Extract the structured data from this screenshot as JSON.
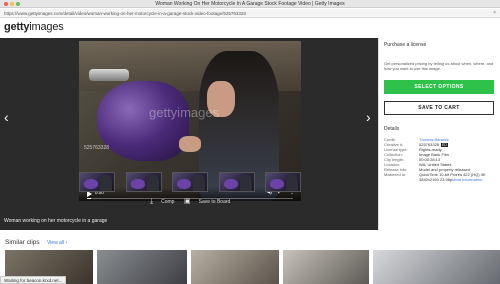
{
  "window": {
    "title": "Woman Working On Her Motorcycle In A Garage Stock Footage Video | Getty Images"
  },
  "browser": {
    "url": "https://www.gettyimages.com/detail/video/woman-working-on-her-motorcycle-in-a-garage-stock-video-footage/525763328",
    "status": "Waiting for beacon.krxd.net..."
  },
  "site": {
    "logo_bold": "getty",
    "logo_light": "images"
  },
  "player": {
    "watermark": "gettyimages",
    "clip_id": "525763328",
    "time": "0:00",
    "progress_fraction": 0.02
  },
  "thumbnails": [
    {
      "label": "thumbnail 1"
    },
    {
      "label": "thumbnail 2"
    },
    {
      "label": "thumbnail 3"
    },
    {
      "label": "thumbnail 4"
    },
    {
      "label": "thumbnail 5"
    }
  ],
  "actions": {
    "comp_label": "Comp",
    "save_label": "Save to Board"
  },
  "caption": "Woman working on her motorcycle in a garage",
  "purchase": {
    "title": "Purchase a license",
    "description": "Get personalized pricing by telling us about when, where, and how you want to use this image.",
    "select_label": "SELECT OPTIONS",
    "cart_label": "SAVE TO CART"
  },
  "details": {
    "title": "Details",
    "rows": [
      {
        "key": "Credit:",
        "value": "Thomas Barwick"
      },
      {
        "key": "Creative #:",
        "value": "525763328"
      },
      {
        "key": "License type:",
        "value": "Rights-ready"
      },
      {
        "key": "Collection:",
        "value": "Image Bank Film"
      },
      {
        "key": "Clip length:",
        "value": "00:00:28:13"
      },
      {
        "key": "Location:",
        "value": "WA, United States"
      },
      {
        "key": "Release info:",
        "value": "Model and property released"
      },
      {
        "key": "Mastered to:",
        "value": "QuickTime 10-bit Prores 422 (HQ) 4K"
      },
      {
        "key": "",
        "value": "3840x2160 23.98p"
      }
    ],
    "badge": "ED",
    "more_info": "More information"
  },
  "similar": {
    "title": "Similar clips",
    "view_all": "View all ›"
  },
  "colors": {
    "accent_green": "#2ec24a",
    "link_blue": "#3a7bd5",
    "dark_panel": "#2b2b2b"
  }
}
